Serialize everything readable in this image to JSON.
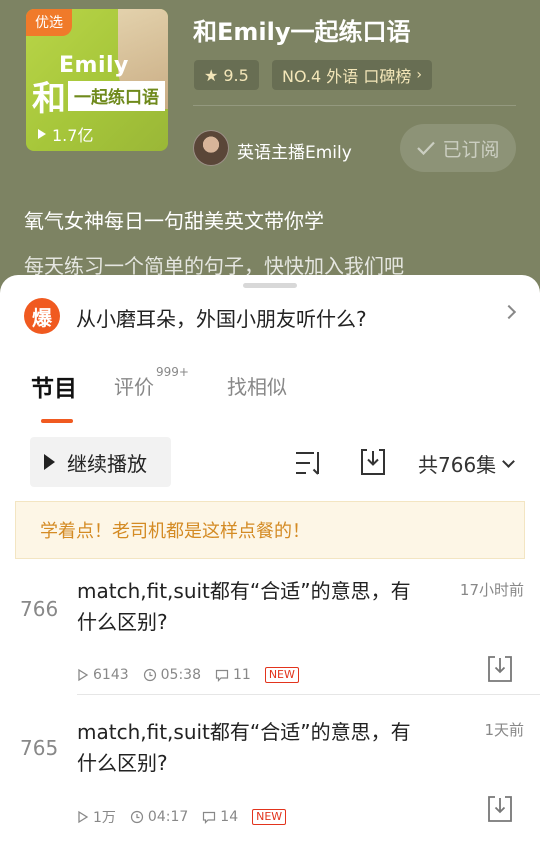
{
  "album": {
    "cover_badge": "优选",
    "cover_line1": "Emily",
    "cover_char": "和",
    "cover_strip": "一起练口语",
    "plays": "1.7亿",
    "title": "和Emily一起练口语",
    "rating_star": "★",
    "rating": "9.5",
    "rank": "NO.4 外语 口碑榜",
    "author": "英语主播Emily",
    "subscribe_label": "已订阅",
    "desc_line1": "氧气女神每日一句甜美英文带你学",
    "desc_line2": "每天练习一个简单的句子，快快加入我们吧"
  },
  "promo": {
    "badge": "爆",
    "text": "从小磨耳朵，外国小朋友听什么?"
  },
  "tabs": [
    {
      "label": "节目",
      "active": true
    },
    {
      "label": "评价",
      "sup": "999+"
    },
    {
      "label": "找相似"
    }
  ],
  "toolbar": {
    "play_label": "继续播放",
    "count_label": "共766集"
  },
  "tip": "学着点！老司机都是这样点餐的！",
  "episodes": [
    {
      "num": "766",
      "title": "match,fit,suit都有“合适”的意思，有什么区别?",
      "time": "17小时前",
      "plays": "6143",
      "duration": "05:38",
      "comments": "11",
      "badge": "NEW"
    },
    {
      "num": "765",
      "title": "match,fit,suit都有“合适”的意思，有什么区别?",
      "time": "1天前",
      "plays": "1万",
      "duration": "04:17",
      "comments": "14",
      "badge": "NEW"
    }
  ],
  "colors": {
    "header_bg": "#7d8363",
    "accent": "#f05a20",
    "tip_text": "#d48b24"
  }
}
